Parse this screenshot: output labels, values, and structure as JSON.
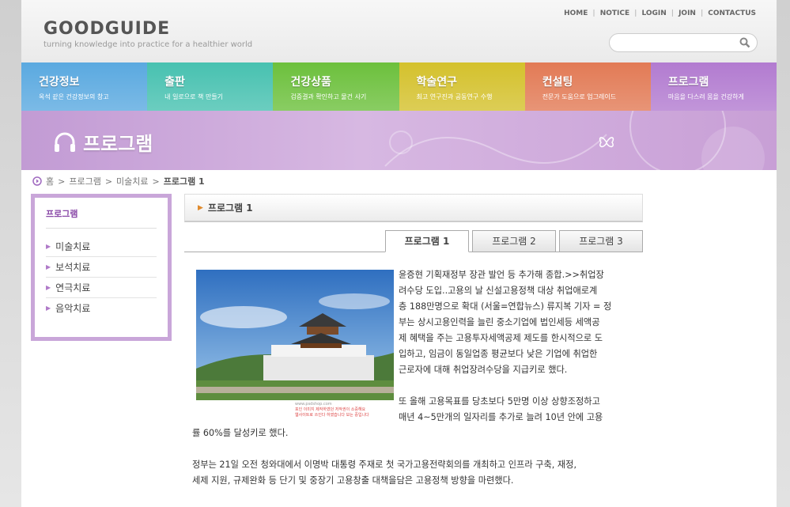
{
  "header": {
    "logo": "GOODGUIDE",
    "tagline": "turning knowledge into practice for a healthier world",
    "top_links": [
      "HOME",
      "NOTICE",
      "LOGIN",
      "JOIN",
      "CONTACTUS"
    ],
    "search": {
      "value": "",
      "placeholder": ""
    }
  },
  "main_nav": [
    {
      "title": "건강정보",
      "subtitle": "옥석 같은 건강정보의 창고",
      "color": "#5aa9e0"
    },
    {
      "title": "출판",
      "subtitle": "내 일로으로 책 만들기",
      "color": "#47c1b0"
    },
    {
      "title": "건강상품",
      "subtitle": "검증결과 확인하고 물건 사기",
      "color": "#6cc03c"
    },
    {
      "title": "학술연구",
      "subtitle": "최고 연구진과 공동연구 수행",
      "color": "#d4c12c"
    },
    {
      "title": "컨설팅",
      "subtitle": "전문가 도움으로 업그레이드",
      "color": "#e27a55"
    },
    {
      "title": "프로그램",
      "subtitle": "마음을 다스려 몸을 건강하게",
      "color": "#b27bd0"
    }
  ],
  "banner": {
    "title": "프로그램"
  },
  "breadcrumb": {
    "items": [
      "홈",
      "프로그램",
      "미술치료"
    ],
    "current": "프로그램 1"
  },
  "sidebar": {
    "heading": "프로그램",
    "items": [
      "미술치료",
      "보석치료",
      "연극치료",
      "음악치료"
    ]
  },
  "content": {
    "heading": "프로그램 1",
    "tabs": [
      "프로그램 1",
      "프로그램 2",
      "프로그램 3"
    ],
    "active_tab": 0,
    "photo_caption": [
      "www.psdshop.com",
      "포인 이미지 제작하였던 저작권이 소중해요",
      "웹사이트로 쓰인다 하였습니다 보는 중입니다"
    ],
    "para1_lines": [
      "윤증현 기획재정부 장관 발언 등 추가해 종합.>>취업장",
      "려수당 도입..고용의 날 신설고용정책 대상 취업애로계",
      "층 188만명으로 확대 (서울=연합뉴스) 류지복 기자 = 정",
      "부는 상시고용인력을 늘린 중소기업에 법인세등 세액공",
      "제 혜택을 주는 고용투자세액공제 제도를 한시적으로 도",
      "입하고, 임금이 동일업종 평균보다 낮은 기업에 취업한",
      "근로자에 대해 취업장려수당을 지급키로 했다."
    ],
    "para2_lines": [
      "또 올해 고용목표를 당초보다 5만명 이상 상향조정하고",
      "매년 4~5만개의 일자리를 추가로 늘려 10년 안에 고용",
      "률 60%를 달성키로 했다."
    ],
    "para3_lines": [
      "정부는 21일 오전 청와대에서 이명박 대통령 주재로 첫 국가고용전략회의를 개최하고 인프라 구축, 재정,",
      "세제 지원, 규제완화 등 단기 및 중장기 고용창출 대책을담은 고용정책 방향을 마련했다."
    ]
  }
}
